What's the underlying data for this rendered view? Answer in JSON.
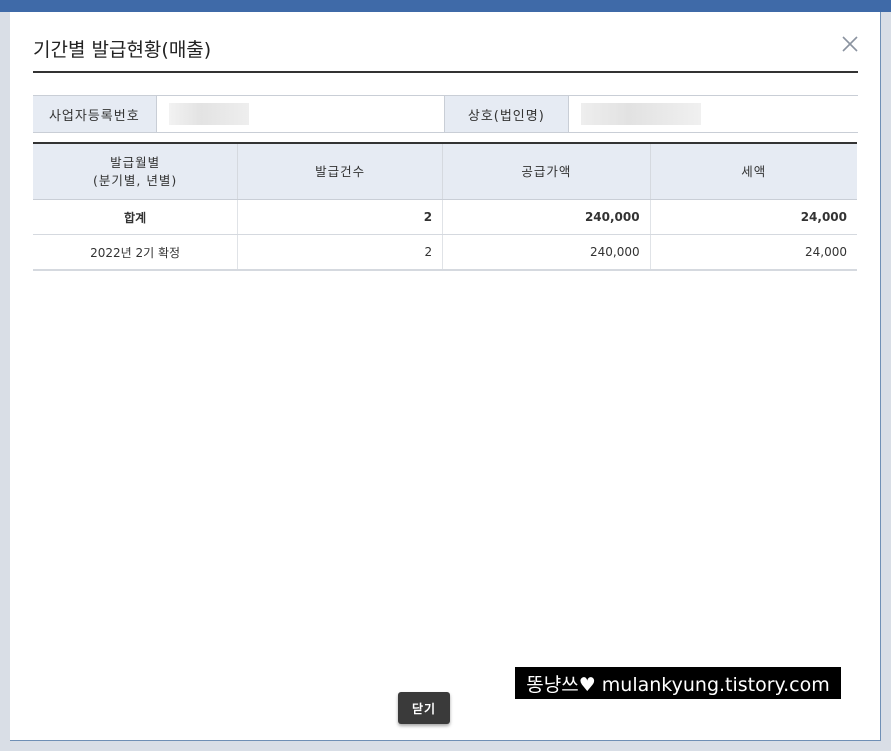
{
  "modal": {
    "title": "기간별 발급현황(매출)",
    "close_icon": "close-icon",
    "info": {
      "business_no_label": "사업자등록번호",
      "company_label": "상호(법인명)"
    },
    "table": {
      "headers": [
        "발급월별\n(분기별, 년별)",
        "발급건수",
        "공급가액",
        "세액"
      ],
      "total": {
        "label": "합계",
        "count": "2",
        "supply": "240,000",
        "tax": "24,000"
      },
      "rows": [
        {
          "period": "2022년 2기 확정",
          "count": "2",
          "supply": "240,000",
          "tax": "24,000"
        }
      ]
    },
    "close_button_label": "닫기"
  },
  "watermark": "똥냥쓰♥ mulankyung.tistory.com",
  "colors": {
    "header_bg": "#e6ebf3",
    "button_bg": "#3a3a3a",
    "backdrop": "#6f8fb5"
  }
}
